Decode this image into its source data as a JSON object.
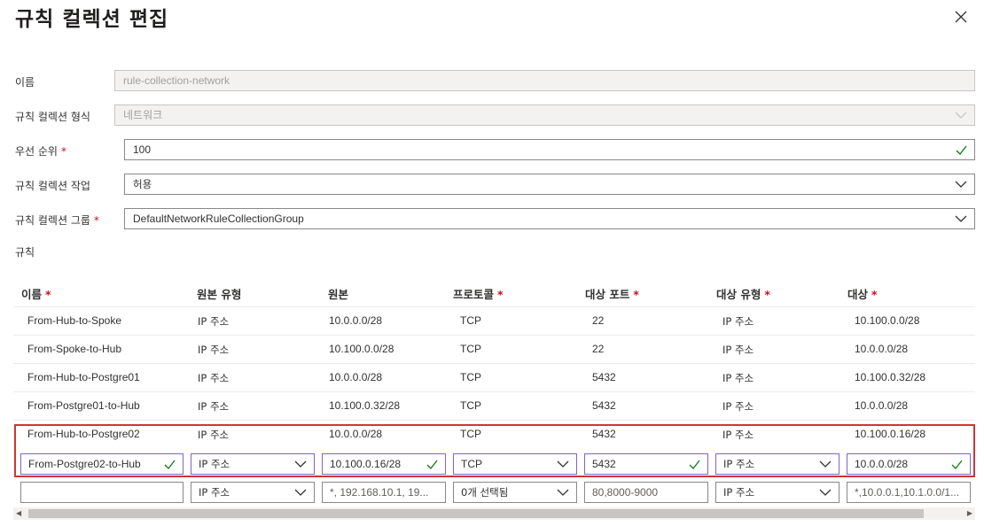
{
  "header": {
    "title": "규칙 컬렉션 편집",
    "close_icon": "close-icon"
  },
  "form": {
    "name_label": "이름",
    "name_value": "rule-collection-network",
    "type_label": "규칙 컬렉션 형식",
    "type_value": "네트워크",
    "priority_label": "우선 순위",
    "priority_value": "100",
    "action_label": "규칙 컬렉션 작업",
    "action_value": "허용",
    "group_label": "규칙 컬렉션 그룹",
    "group_value": "DefaultNetworkRuleCollectionGroup",
    "rules_label": "규칙",
    "required_marker": "*"
  },
  "table": {
    "headers": {
      "name": "이름",
      "source_type": "원본 유형",
      "source": "원본",
      "protocol": "프로토콜",
      "dest_ports": "대상 포트",
      "dest_type": "대상 유형",
      "dest": "대상"
    },
    "rows": [
      {
        "name": "From-Hub-to-Spoke",
        "source_type": "IP 주소",
        "source": "10.0.0.0/28",
        "protocol": "TCP",
        "dest_ports": "22",
        "dest_type": "IP 주소",
        "dest": "10.100.0.0/28"
      },
      {
        "name": "From-Spoke-to-Hub",
        "source_type": "IP 주소",
        "source": "10.100.0.0/28",
        "protocol": "TCP",
        "dest_ports": "22",
        "dest_type": "IP 주소",
        "dest": "10.0.0.0/28"
      },
      {
        "name": "From-Hub-to-Postgre01",
        "source_type": "IP 주소",
        "source": "10.0.0.0/28",
        "protocol": "TCP",
        "dest_ports": "5432",
        "dest_type": "IP 주소",
        "dest": "10.100.0.32/28"
      },
      {
        "name": "From-Postgre01-to-Hub",
        "source_type": "IP 주소",
        "source": "10.100.0.32/28",
        "protocol": "TCP",
        "dest_ports": "5432",
        "dest_type": "IP 주소",
        "dest": "10.0.0.0/28"
      },
      {
        "name": "From-Hub-to-Postgre02",
        "source_type": "IP 주소",
        "source": "10.0.0.0/28",
        "protocol": "TCP",
        "dest_ports": "5432",
        "dest_type": "IP 주소",
        "dest": "10.100.0.16/28"
      }
    ],
    "edit_row": {
      "name": "From-Postgre02-to-Hub",
      "source_type": "IP 주소",
      "source": "10.100.0.16/28",
      "protocol": "TCP",
      "dest_ports": "5432",
      "dest_type": "IP 주소",
      "dest": "10.0.0.0/28"
    },
    "new_row": {
      "name": "",
      "source_type": "IP 주소",
      "source_placeholder": "*, 192.168.10.1, 19...",
      "protocol_placeholder": "0개 선택됨",
      "dest_ports_placeholder": "80,8000-9000",
      "dest_type": "IP 주소",
      "dest_placeholder": "*,10.0.0.1,10.1.0.0/1..."
    }
  },
  "colors": {
    "accent_border": "#8661c5",
    "valid_check": "#107c10",
    "highlight": "#d13438",
    "required": "#c50f1f"
  }
}
